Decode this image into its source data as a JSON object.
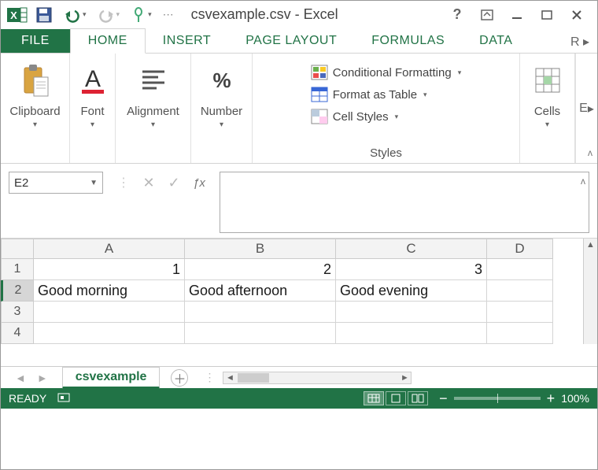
{
  "window": {
    "title": "csvexample.csv - Excel"
  },
  "tabs": {
    "file": "FILE",
    "home": "HOME",
    "insert": "INSERT",
    "page_layout": "PAGE LAYOUT",
    "formulas": "FORMULAS",
    "data": "DATA",
    "overflow": "R"
  },
  "ribbon": {
    "clipboard": "Clipboard",
    "font": "Font",
    "alignment": "Alignment",
    "number": "Number",
    "styles": {
      "conditional": "Conditional Formatting",
      "format_table": "Format as Table",
      "cell_styles": "Cell Styles",
      "label": "Styles"
    },
    "cells": "Cells",
    "editing_overflow": "E"
  },
  "formula_bar": {
    "name_box": "E2",
    "fx": "ƒx",
    "value": ""
  },
  "grid": {
    "columns": [
      "A",
      "B",
      "C",
      "D"
    ],
    "rows": [
      "1",
      "2",
      "3",
      "4"
    ],
    "cells": {
      "A1": "1",
      "B1": "2",
      "C1": "3",
      "D1": "",
      "A2": "Good morning",
      "B2": "Good afternoon",
      "C2": "Good evening",
      "D2": "",
      "A3": "",
      "B3": "",
      "C3": "",
      "D3": "",
      "A4": "",
      "B4": "",
      "C4": "",
      "D4": ""
    }
  },
  "sheet_tabs": {
    "active": "csvexample"
  },
  "status": {
    "ready": "READY",
    "zoom": "100%"
  }
}
